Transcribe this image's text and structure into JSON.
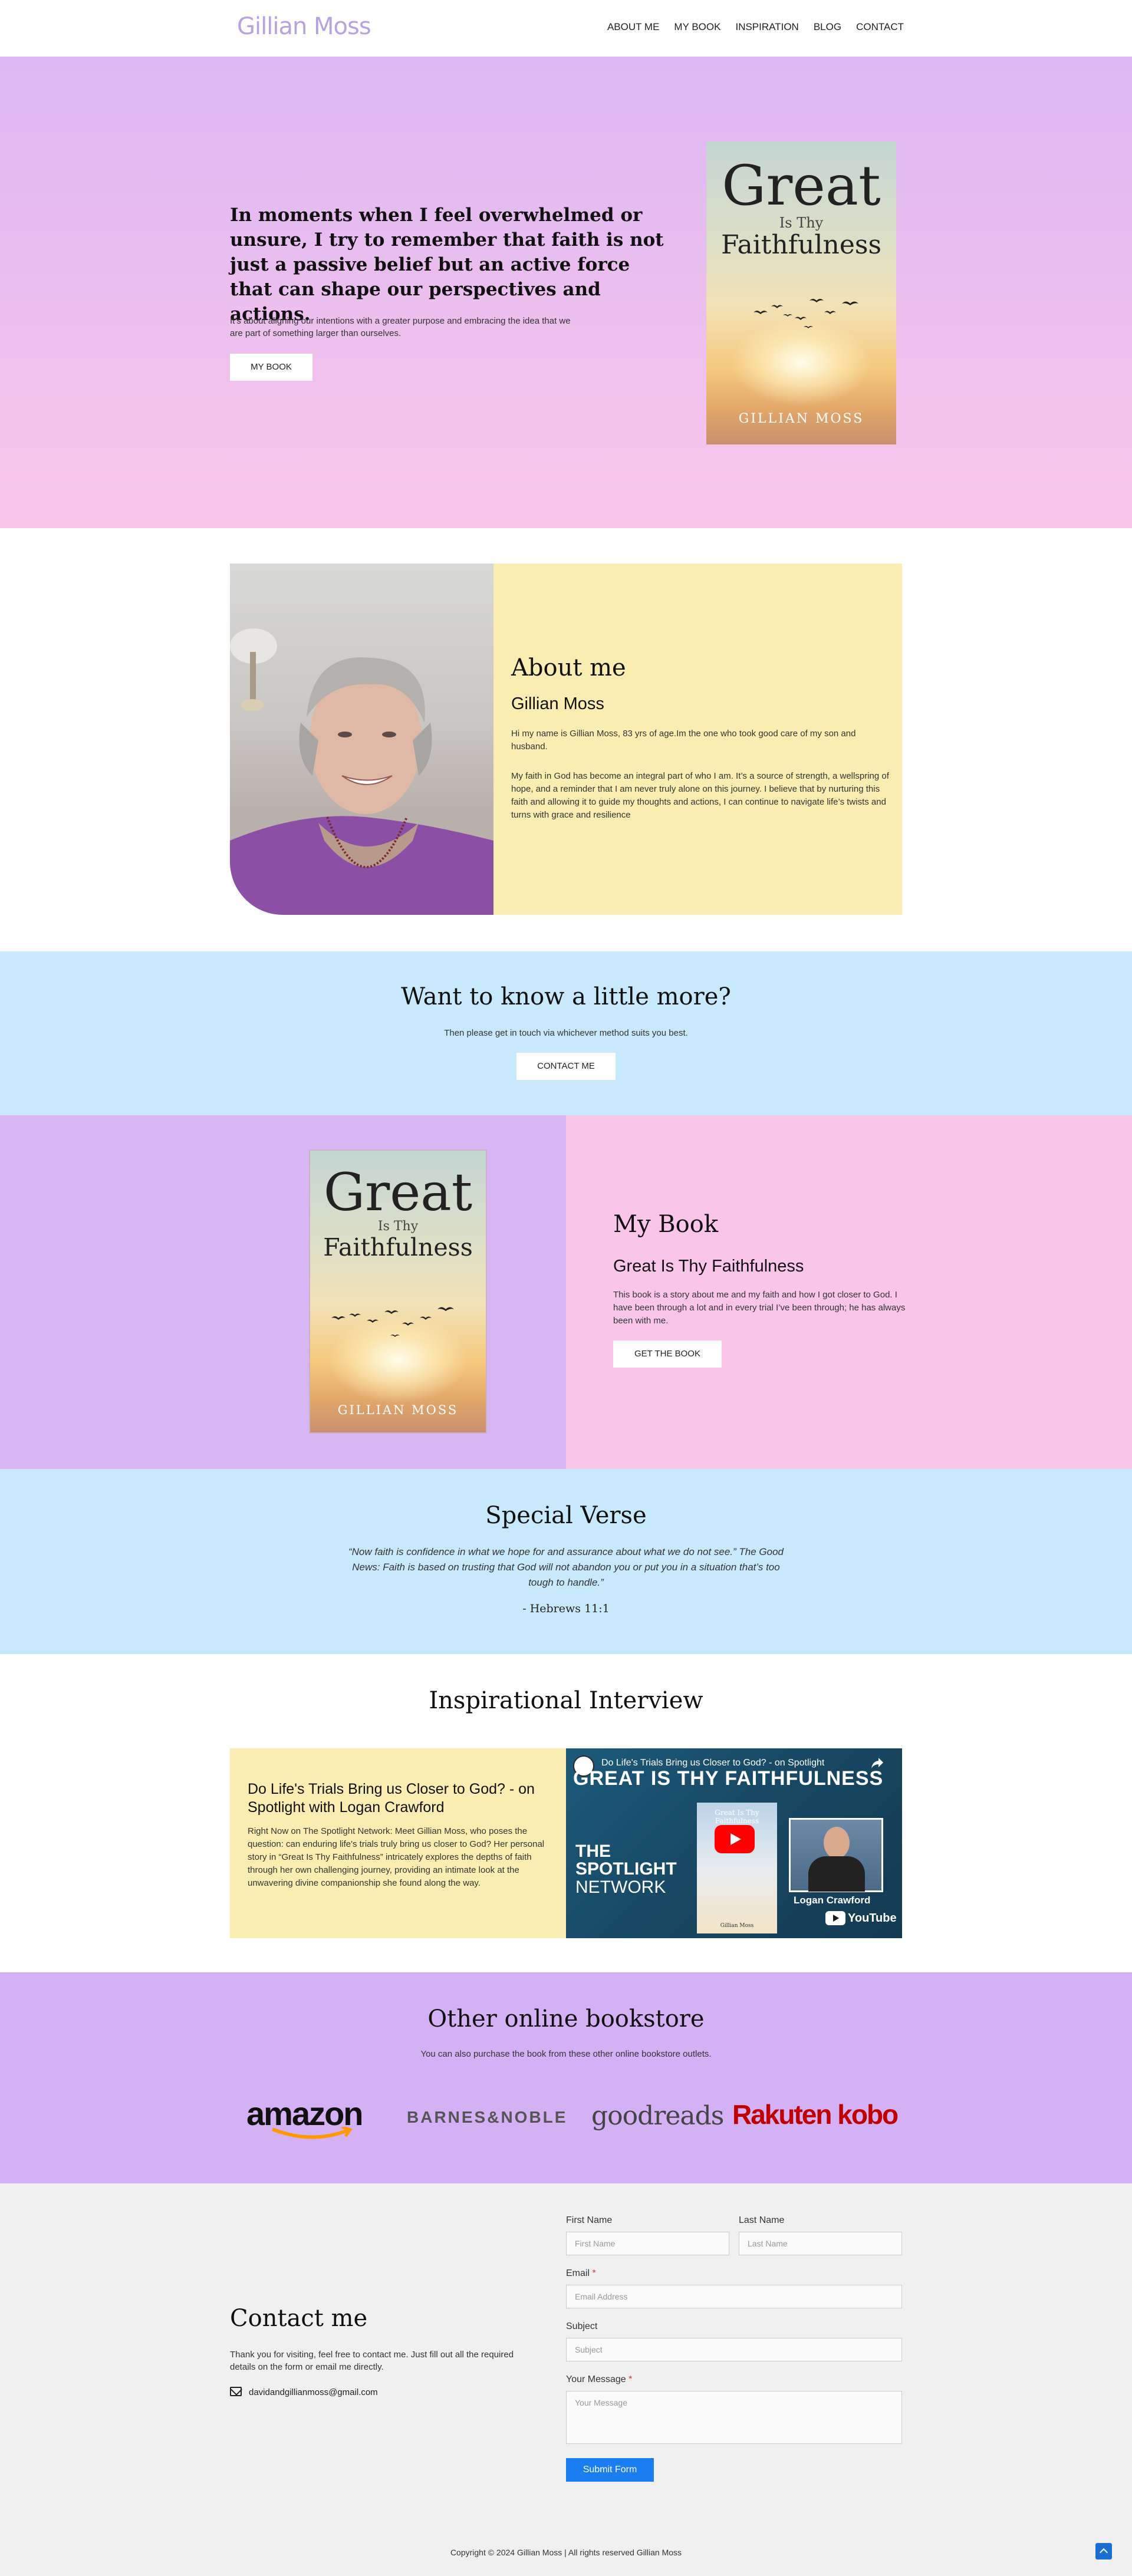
{
  "header": {
    "logo": "Gillian Moss",
    "nav": [
      "ABOUT ME",
      "MY BOOK",
      "INSPIRATION",
      "BLOG",
      "CONTACT"
    ]
  },
  "hero": {
    "quote": "In moments when I feel overwhelmed or unsure, I try to remember that faith is not just a passive belief but an active force that can shape our perspectives and actions.",
    "subtext": "It’s about aligning our intentions with a greater purpose and embracing the idea that we are part of something larger than ourselves.",
    "button": "MY BOOK"
  },
  "book_cover": {
    "title_line1": "Great",
    "title_line2": "Is Thy",
    "title_line3": "Faithfulness",
    "author": "GILLIAN MOSS"
  },
  "about": {
    "title": "About me",
    "name": "Gillian Moss",
    "p1": "Hi my name is Gillian Moss, 83 yrs of age.Im the one who took good care of my son and husband.",
    "p2": "My faith in God has become an integral part of who I am. It’s a source of strength, a wellspring of hope, and a reminder that I am never truly alone on this journey. I believe that by nurturing this faith and allowing it to guide my thoughts and actions, I can continue to navigate life’s twists and turns with grace and resilience"
  },
  "know_more": {
    "title": "Want to know a little more?",
    "subtitle": "Then please get in touch via whichever method suits you best.",
    "button": "CONTACT ME"
  },
  "my_book": {
    "title": "My Book",
    "subtitle": "Great Is Thy Faithfulness",
    "description": "This book is a story about me and my faith and how I got closer to God. I have been through a lot and in every trial I’ve been through; he has always been with me.",
    "button": "GET THE BOOK"
  },
  "verse": {
    "title": "Special Verse",
    "text": "“Now faith is confidence in what we hope for and assurance about what we do not see.” The Good News: Faith is based on trusting that God will not abandon you or put you in a situation that’s too tough to handle.”",
    "reference": "- Hebrews 11:1"
  },
  "interview": {
    "title": "Inspirational Interview",
    "headline": "Do Life's Trials Bring us Closer to God? - on Spotlight with Logan Crawford",
    "description": "Right Now on The Spotlight Network: Meet Gillian Moss, who poses the question: can enduring life's trials truly bring us closer to God? Her personal story in “Great Is Thy Faithfulness” intricately explores the depths of faith through her own challenging journey, providing an intimate look at the unwavering divine companionship she found along the way.",
    "video": {
      "top_title": "Do Life's Trials Bring us Closer to God? - on Spotlight",
      "banner": "GREAT IS THY FAITHFULNESS",
      "network_line1": "THE",
      "network_line2": "SPOTLIGHT",
      "network_line3": "NETWORK",
      "host": "Logan Crawford",
      "platform": "YouTube",
      "mini_cover_title": "Great Is Thy Faithfulness",
      "mini_cover_author": "Gillian Moss"
    }
  },
  "stores": {
    "title": "Other online bookstore",
    "subtitle": "You can also purchase the book from these other online bookstore outlets.",
    "logos": [
      "amazon",
      "BARNES&NOBLE",
      "goodreads",
      "Rakuten kobo"
    ]
  },
  "contact": {
    "title": "Contact me",
    "intro": "Thank you for visiting, feel free to contact me. Just fill out all the required details on the form or email me directly.",
    "email": "davidandgillianmoss@gmail.com",
    "form": {
      "first_name_label": "First Name",
      "first_name_placeholder": "First Name",
      "last_name_label": "Last Name",
      "last_name_placeholder": "Last Name",
      "email_label": "Email",
      "email_placeholder": "Email Address",
      "subject_label": "Subject",
      "subject_placeholder": "Subject",
      "message_label": "Your Message",
      "message_placeholder": "Your Message",
      "required_mark": "*",
      "submit": "Submit Form"
    }
  },
  "footer": {
    "copyright": "Copyright © 2024 Gillian Moss | All rights reserved Gillian Moss"
  },
  "colors": {
    "hero_top": "#dcb7f3",
    "hero_bottom": "#f9c6ea",
    "yellow": "#f9edb1",
    "light_blue": "#c8e9fb",
    "lavender": "#d3b1f4",
    "pink": "#f9c6ea",
    "submit_blue": "#1a7ef0"
  }
}
